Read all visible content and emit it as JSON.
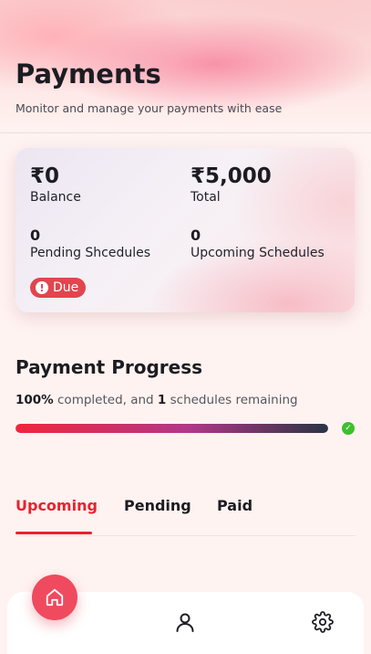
{
  "header": {
    "title": "Payments",
    "subtitle": "Monitor and manage your payments with ease"
  },
  "summary": {
    "balance_value": "₹0",
    "balance_label": "Balance",
    "total_value": "₹5,000",
    "total_label": "Total",
    "pending_count": "0",
    "pending_label": "Pending Shcedules",
    "upcoming_count": "0",
    "upcoming_label": "Upcoming Schedules",
    "due_badge": "Due",
    "due_color": "#e0464f"
  },
  "progress": {
    "title": "Payment Progress",
    "percent_text": "100%",
    "mid_text": " completed, and ",
    "remaining_count": "1",
    "end_text": " schedules remaining",
    "fraction": 1.0,
    "complete_icon": "check-circle-icon"
  },
  "tabs": {
    "items": [
      {
        "label": "Upcoming",
        "active": true
      },
      {
        "label": "Pending",
        "active": false
      },
      {
        "label": "Paid",
        "active": false
      }
    ],
    "active_color": "#e8222f"
  },
  "bottom_nav": {
    "items": [
      {
        "icon": "home-icon",
        "active": true
      },
      {
        "icon": "user-icon",
        "active": false
      },
      {
        "icon": "gear-icon",
        "active": false
      }
    ],
    "accent": "#ef4a5e"
  }
}
